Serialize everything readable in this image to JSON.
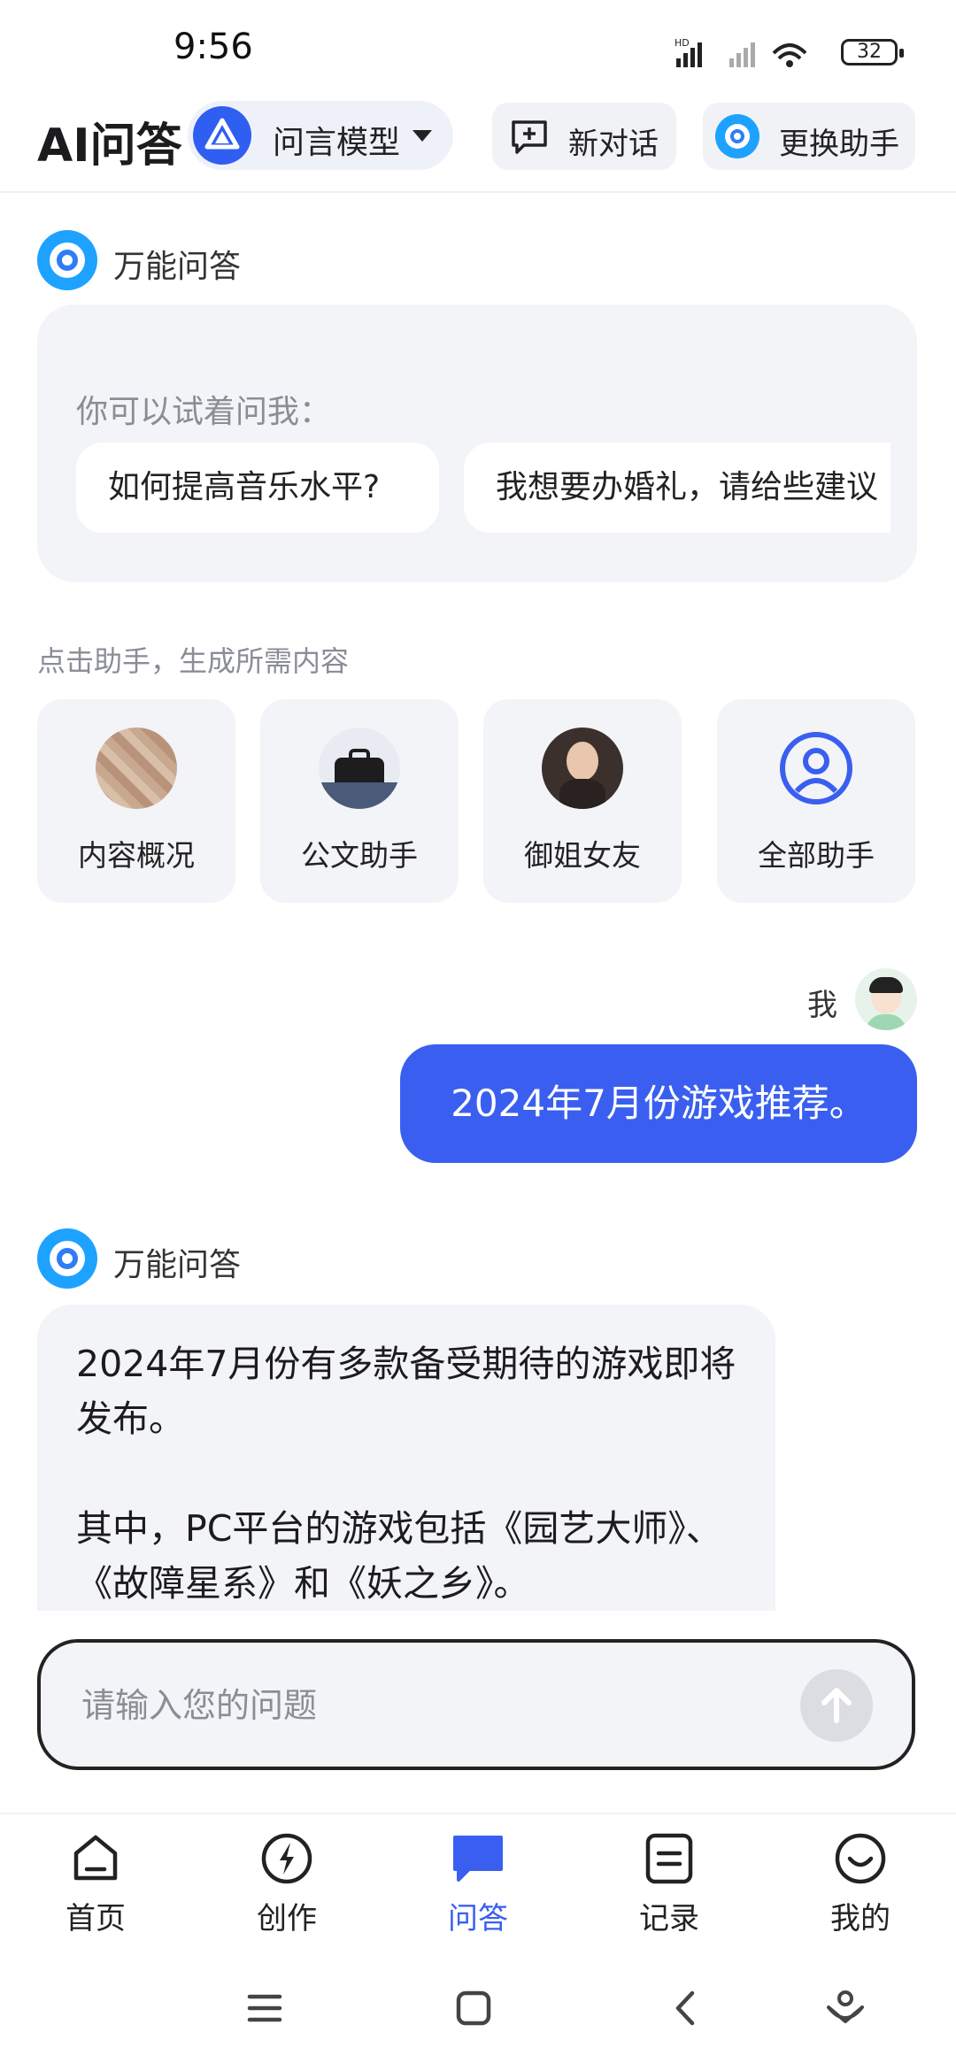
{
  "status": {
    "time": "9:56",
    "battery": "32"
  },
  "header": {
    "title": "AI问答",
    "model_name": "问言模型",
    "new_chat_label": "新对话",
    "switch_assistant_label": "更换助手"
  },
  "bot": {
    "name": "万能问答"
  },
  "suggestions": {
    "hint": "你可以试着问我：",
    "chips": [
      "如何提高音乐水平?",
      "我想要办婚礼，请给些建议"
    ]
  },
  "assistants_section": {
    "label": "点击助手，生成所需内容",
    "items": [
      {
        "label": "内容概况"
      },
      {
        "label": "公文助手"
      },
      {
        "label": "御姐女友"
      },
      {
        "label": "全部助手"
      }
    ]
  },
  "user_message": {
    "sender": "我",
    "text": "2024年7月份游戏推荐。"
  },
  "answer": {
    "bot_name": "万能问答",
    "paragraphs": [
      "2024年7月份有多款备受期待的游戏即将发布。",
      "其中，PC平台的游戏包括《园艺大师》、《故障星系》和《妖之乡》。"
    ]
  },
  "input": {
    "placeholder": "请输入您的问题"
  },
  "tabbar": {
    "items": [
      {
        "label": "首页",
        "icon": "home-icon"
      },
      {
        "label": "创作",
        "icon": "bolt-icon"
      },
      {
        "label": "问答",
        "icon": "chat-icon",
        "active": true
      },
      {
        "label": "记录",
        "icon": "record-icon"
      },
      {
        "label": "我的",
        "icon": "smile-icon"
      }
    ]
  },
  "colors": {
    "accent": "#3a5ff0",
    "bot_blue": "#1ea2ff",
    "card_bg": "#f3f4f7"
  }
}
